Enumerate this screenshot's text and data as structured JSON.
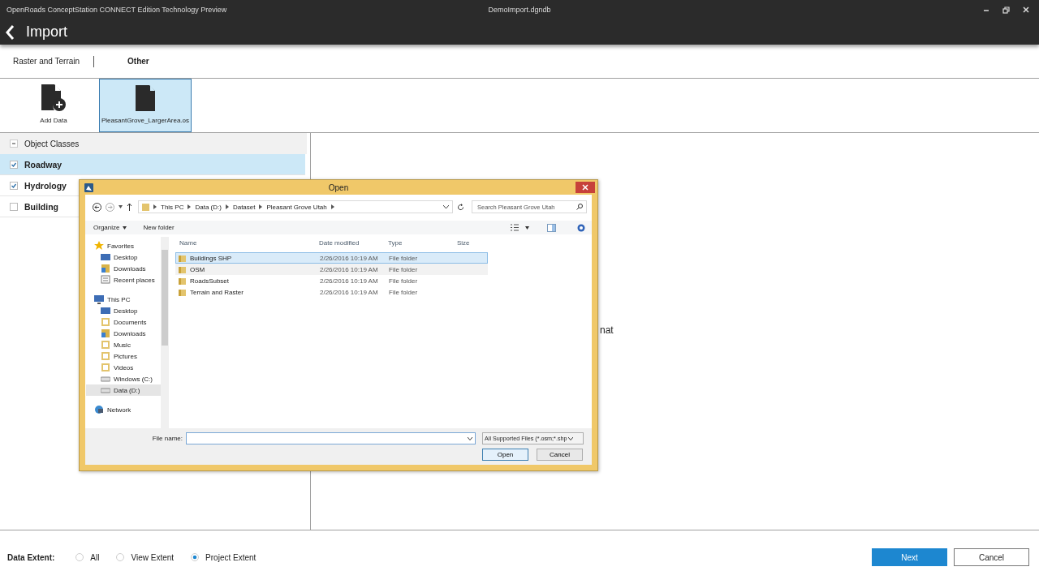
{
  "window": {
    "title": "OpenRoads ConceptStation CONNECT Edition Technology Preview",
    "document": "DemoImport.dgndb"
  },
  "header": {
    "title": "Import"
  },
  "tabs": [
    {
      "label": "Raster and Terrain",
      "selected": false
    },
    {
      "label": "Other",
      "selected": true
    }
  ],
  "tiles": [
    {
      "kind": "add",
      "label": "Add Data",
      "selected": false
    },
    {
      "kind": "file",
      "label": "PleasantGrove_LargerArea.os",
      "selected": true
    }
  ],
  "object_classes": {
    "label": "Object Classes",
    "expanded": true,
    "children": [
      {
        "label": "Roadway",
        "checked": true,
        "selected": true
      },
      {
        "label": "Hydrology",
        "checked": true,
        "selected": false
      },
      {
        "label": "Building",
        "checked": false,
        "selected": false
      }
    ]
  },
  "detail_text": "nat",
  "dialog": {
    "title": "Open",
    "breadcrumb": [
      "This PC",
      "Data (D:)",
      "Dataset",
      "Pleasant Grove Utah"
    ],
    "search": {
      "placeholder": "Search Pleasant Grove Utah"
    },
    "toolbar": {
      "organize": "Organize",
      "new_folder": "New folder"
    },
    "nav": [
      {
        "label": "Favorites",
        "kind": "star",
        "selected": false,
        "children": [
          {
            "label": "Desktop",
            "kind": "desktop",
            "selected": false
          },
          {
            "label": "Downloads",
            "kind": "downloads",
            "selected": false
          },
          {
            "label": "Recent places",
            "kind": "places",
            "selected": false
          }
        ]
      },
      {
        "label": "This PC",
        "kind": "pc",
        "selected": false,
        "children": [
          {
            "label": "Desktop",
            "kind": "desktop",
            "selected": false
          },
          {
            "label": "Documents",
            "kind": "folder",
            "selected": false
          },
          {
            "label": "Downloads",
            "kind": "downloads",
            "selected": false
          },
          {
            "label": "Music",
            "kind": "folder",
            "selected": false
          },
          {
            "label": "Pictures",
            "kind": "folder",
            "selected": false
          },
          {
            "label": "Videos",
            "kind": "folder",
            "selected": false
          },
          {
            "label": "Windows (C:)",
            "kind": "drive",
            "selected": false
          },
          {
            "label": "Data (D:)",
            "kind": "drive",
            "selected": true
          }
        ]
      },
      {
        "label": "Network",
        "kind": "network",
        "selected": false
      }
    ],
    "columns": [
      "Name",
      "Date modified",
      "Type",
      "Size"
    ],
    "rows": [
      {
        "name": "Buildings SHP",
        "date": "2/26/2016 10:19 AM",
        "type": "File folder",
        "selected": true
      },
      {
        "name": "OSM",
        "date": "2/26/2016 10:19 AM",
        "type": "File folder",
        "selected": false
      },
      {
        "name": "RoadsSubset",
        "date": "2/26/2016 10:19 AM",
        "type": "File folder",
        "selected": false
      },
      {
        "name": "Terrain and Raster",
        "date": "2/26/2016 10:19 AM",
        "type": "File folder",
        "selected": false
      }
    ],
    "file_name": {
      "label": "File name:"
    },
    "filter": "All Supported Files (*.osm;*.shp",
    "buttons": [
      {
        "label": "Open",
        "kind": "default"
      },
      {
        "label": "Cancel",
        "kind": "normal"
      }
    ]
  },
  "footer": {
    "label": "Data Extent:",
    "options": [
      {
        "label": "All",
        "selected": false
      },
      {
        "label": "View Extent",
        "selected": false
      },
      {
        "label": "Project Extent",
        "selected": true
      }
    ],
    "buttons": [
      {
        "label": "Next",
        "kind": "primary"
      },
      {
        "label": "Cancel",
        "kind": "secondary"
      }
    ]
  }
}
